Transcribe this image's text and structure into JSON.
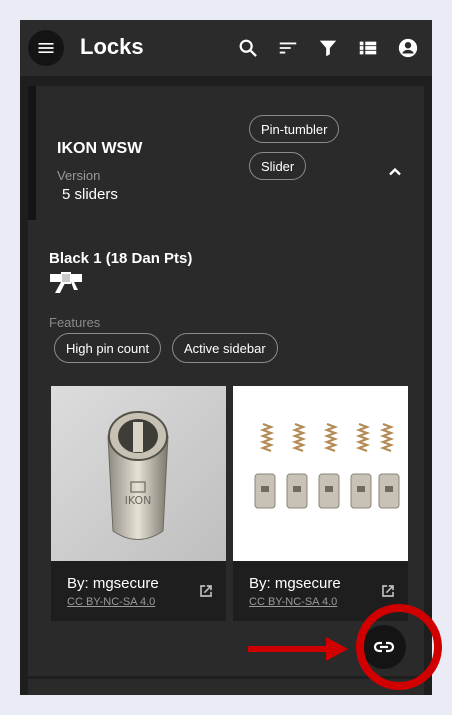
{
  "appbar": {
    "title": "Locks",
    "icons": [
      "menu-icon",
      "search-icon",
      "sort-icon",
      "filter-icon",
      "list-view-icon",
      "account-icon"
    ]
  },
  "lock": {
    "name": "IKON WSW",
    "version_label": "Version",
    "version_value": "5 sliders",
    "tags": [
      "Pin-tumbler",
      "Slider"
    ]
  },
  "belt": {
    "name": "Black 1 (18 Dan Pts)",
    "icon": "belt-icon",
    "color": "#ffffff"
  },
  "features": {
    "label": "Features",
    "items": [
      "High pin count",
      "Active sidebar"
    ]
  },
  "media": [
    {
      "by": "By: mgsecure",
      "license": "CC BY-NC-SA 4.0",
      "image": "key-cylinder-photo"
    },
    {
      "by": "By: mgsecure",
      "license": "CC BY-NC-SA 4.0",
      "image": "pins-springs-photo"
    }
  ],
  "colors": {
    "accent_highlight": "#d10000",
    "background": "#1e1e1e",
    "page_bg": "#e9ecf4"
  }
}
